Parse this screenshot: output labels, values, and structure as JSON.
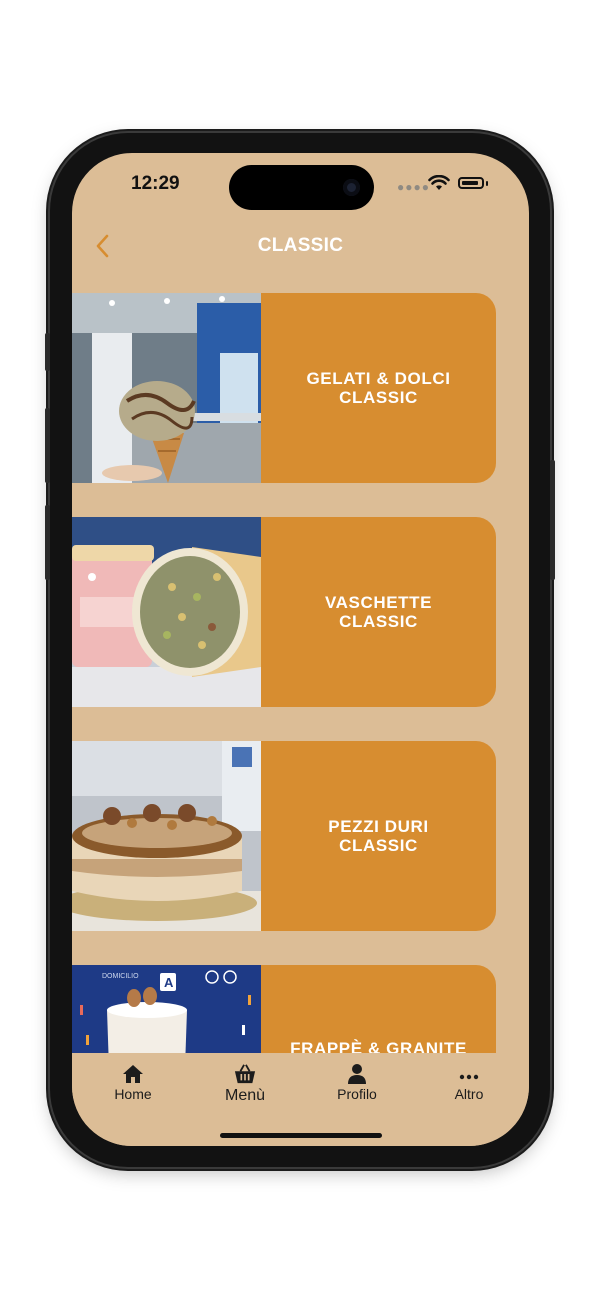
{
  "status_bar": {
    "time": "12:29",
    "signal_icon": "signal-dots-icon",
    "wifi_icon": "wifi-icon",
    "battery_icon": "battery-icon"
  },
  "header": {
    "title": "CLASSIC",
    "back_icon": "chevron-left-icon"
  },
  "categories": [
    {
      "label": "GELATI & DOLCI\nCLASSIC",
      "image": "gelato-cone-photo"
    },
    {
      "label": "VASCHETTE\nCLASSIC",
      "image": "pistachio-tub-photo"
    },
    {
      "label": "PEZZI DURI\nCLASSIC",
      "image": "semifreddo-cake-photo"
    },
    {
      "label": "FRAPPÈ & GRANITE",
      "image": "frappe-glass-photo",
      "image_texts": {
        "word": "DOMICILIO",
        "logo": "A"
      }
    }
  ],
  "tab_bar": {
    "items": [
      {
        "label": "Home",
        "icon": "home-icon"
      },
      {
        "label": "Menù",
        "icon": "basket-icon",
        "active": true
      },
      {
        "label": "Profilo",
        "icon": "user-icon"
      },
      {
        "label": "Altro",
        "icon": "more-dots-icon"
      }
    ]
  },
  "colors": {
    "background": "#dcbd96",
    "card": "#d78d30",
    "accent": "#d78d30",
    "text_light": "#ffffff"
  }
}
